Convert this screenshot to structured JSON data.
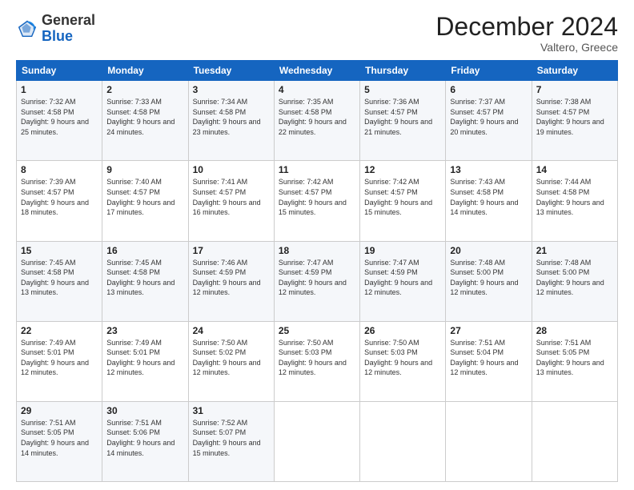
{
  "logo": {
    "general": "General",
    "blue": "Blue"
  },
  "header": {
    "month": "December 2024",
    "location": "Valtero, Greece"
  },
  "weekdays": [
    "Sunday",
    "Monday",
    "Tuesday",
    "Wednesday",
    "Thursday",
    "Friday",
    "Saturday"
  ],
  "weeks": [
    [
      {
        "day": 1,
        "sunrise": "7:32 AM",
        "sunset": "4:58 PM",
        "daylight": "9 hours and 25 minutes."
      },
      {
        "day": 2,
        "sunrise": "7:33 AM",
        "sunset": "4:58 PM",
        "daylight": "9 hours and 24 minutes."
      },
      {
        "day": 3,
        "sunrise": "7:34 AM",
        "sunset": "4:58 PM",
        "daylight": "9 hours and 23 minutes."
      },
      {
        "day": 4,
        "sunrise": "7:35 AM",
        "sunset": "4:58 PM",
        "daylight": "9 hours and 22 minutes."
      },
      {
        "day": 5,
        "sunrise": "7:36 AM",
        "sunset": "4:57 PM",
        "daylight": "9 hours and 21 minutes."
      },
      {
        "day": 6,
        "sunrise": "7:37 AM",
        "sunset": "4:57 PM",
        "daylight": "9 hours and 20 minutes."
      },
      {
        "day": 7,
        "sunrise": "7:38 AM",
        "sunset": "4:57 PM",
        "daylight": "9 hours and 19 minutes."
      }
    ],
    [
      {
        "day": 8,
        "sunrise": "7:39 AM",
        "sunset": "4:57 PM",
        "daylight": "9 hours and 18 minutes."
      },
      {
        "day": 9,
        "sunrise": "7:40 AM",
        "sunset": "4:57 PM",
        "daylight": "9 hours and 17 minutes."
      },
      {
        "day": 10,
        "sunrise": "7:41 AM",
        "sunset": "4:57 PM",
        "daylight": "9 hours and 16 minutes."
      },
      {
        "day": 11,
        "sunrise": "7:42 AM",
        "sunset": "4:57 PM",
        "daylight": "9 hours and 15 minutes."
      },
      {
        "day": 12,
        "sunrise": "7:42 AM",
        "sunset": "4:57 PM",
        "daylight": "9 hours and 15 minutes."
      },
      {
        "day": 13,
        "sunrise": "7:43 AM",
        "sunset": "4:58 PM",
        "daylight": "9 hours and 14 minutes."
      },
      {
        "day": 14,
        "sunrise": "7:44 AM",
        "sunset": "4:58 PM",
        "daylight": "9 hours and 13 minutes."
      }
    ],
    [
      {
        "day": 15,
        "sunrise": "7:45 AM",
        "sunset": "4:58 PM",
        "daylight": "9 hours and 13 minutes."
      },
      {
        "day": 16,
        "sunrise": "7:45 AM",
        "sunset": "4:58 PM",
        "daylight": "9 hours and 13 minutes."
      },
      {
        "day": 17,
        "sunrise": "7:46 AM",
        "sunset": "4:59 PM",
        "daylight": "9 hours and 12 minutes."
      },
      {
        "day": 18,
        "sunrise": "7:47 AM",
        "sunset": "4:59 PM",
        "daylight": "9 hours and 12 minutes."
      },
      {
        "day": 19,
        "sunrise": "7:47 AM",
        "sunset": "4:59 PM",
        "daylight": "9 hours and 12 minutes."
      },
      {
        "day": 20,
        "sunrise": "7:48 AM",
        "sunset": "5:00 PM",
        "daylight": "9 hours and 12 minutes."
      },
      {
        "day": 21,
        "sunrise": "7:48 AM",
        "sunset": "5:00 PM",
        "daylight": "9 hours and 12 minutes."
      }
    ],
    [
      {
        "day": 22,
        "sunrise": "7:49 AM",
        "sunset": "5:01 PM",
        "daylight": "9 hours and 12 minutes."
      },
      {
        "day": 23,
        "sunrise": "7:49 AM",
        "sunset": "5:01 PM",
        "daylight": "9 hours and 12 minutes."
      },
      {
        "day": 24,
        "sunrise": "7:50 AM",
        "sunset": "5:02 PM",
        "daylight": "9 hours and 12 minutes."
      },
      {
        "day": 25,
        "sunrise": "7:50 AM",
        "sunset": "5:03 PM",
        "daylight": "9 hours and 12 minutes."
      },
      {
        "day": 26,
        "sunrise": "7:50 AM",
        "sunset": "5:03 PM",
        "daylight": "9 hours and 12 minutes."
      },
      {
        "day": 27,
        "sunrise": "7:51 AM",
        "sunset": "5:04 PM",
        "daylight": "9 hours and 12 minutes."
      },
      {
        "day": 28,
        "sunrise": "7:51 AM",
        "sunset": "5:05 PM",
        "daylight": "9 hours and 13 minutes."
      }
    ],
    [
      {
        "day": 29,
        "sunrise": "7:51 AM",
        "sunset": "5:05 PM",
        "daylight": "9 hours and 14 minutes."
      },
      {
        "day": 30,
        "sunrise": "7:51 AM",
        "sunset": "5:06 PM",
        "daylight": "9 hours and 14 minutes."
      },
      {
        "day": 31,
        "sunrise": "7:52 AM",
        "sunset": "5:07 PM",
        "daylight": "9 hours and 15 minutes."
      },
      null,
      null,
      null,
      null
    ]
  ]
}
